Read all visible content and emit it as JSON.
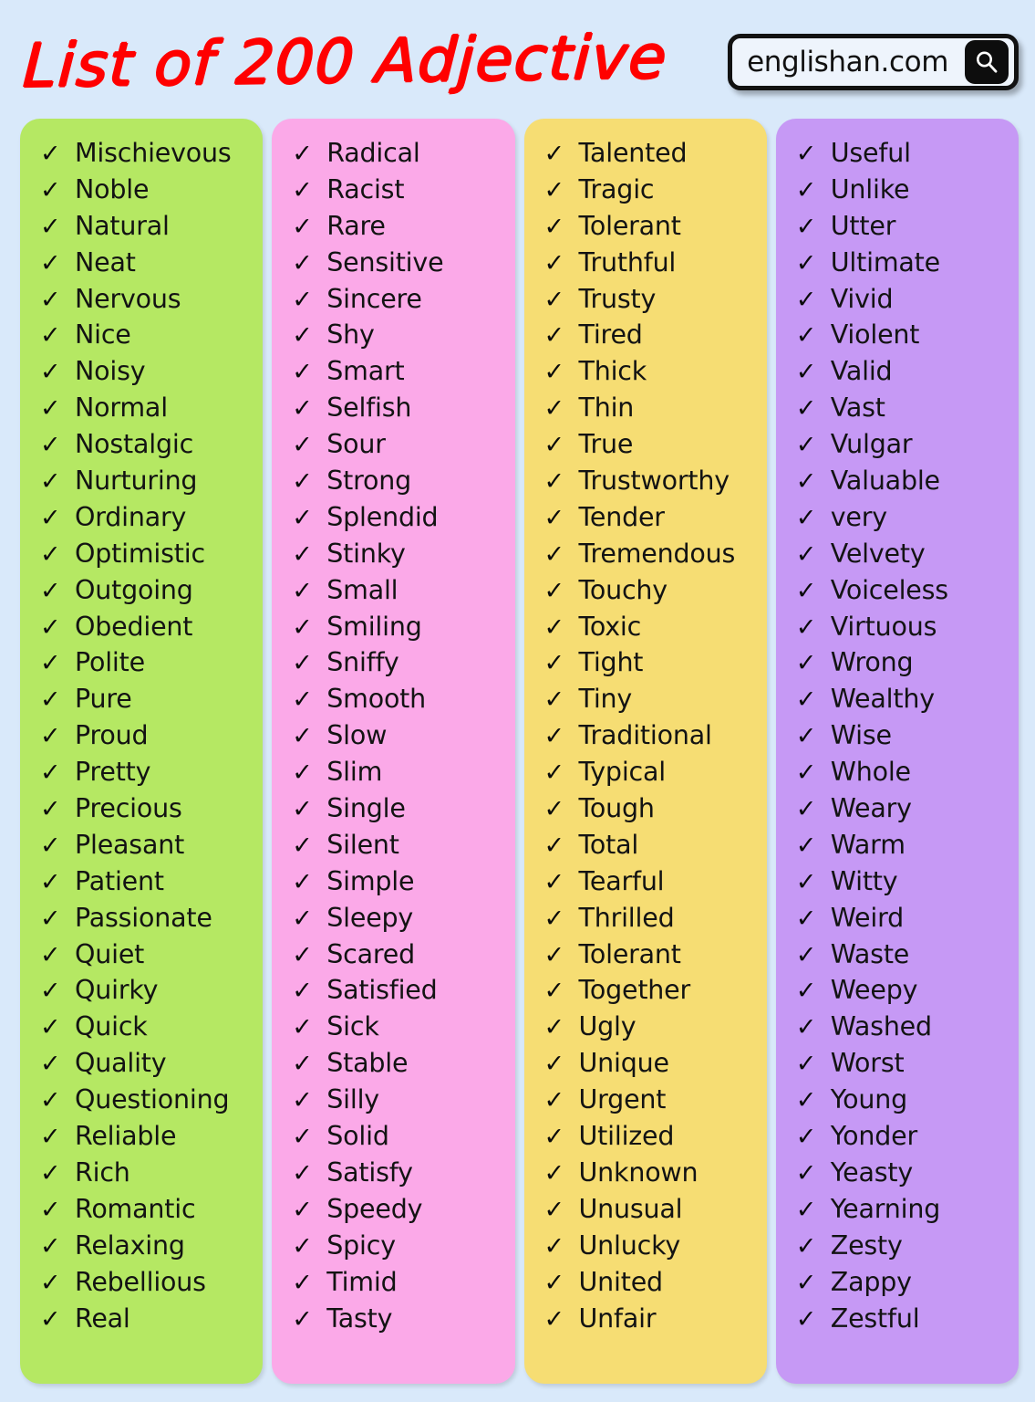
{
  "header": {
    "title": "List of 200 Adjective",
    "search": {
      "site_label": "englishan.com",
      "button_icon": "search-icon"
    }
  },
  "theme": {
    "page_background": "#d9e9fa",
    "title_color": "#ff0000",
    "column_colors": [
      "#b5e863",
      "#fba9e8",
      "#f6dd73",
      "#c699f5"
    ],
    "text_color": "#131313"
  },
  "bullet_icon": "check-icon",
  "bullet_glyph": "✓",
  "columns": [
    {
      "name": "column-green",
      "color": "#b5e863",
      "words": [
        "Mischievous",
        "Noble",
        "Natural",
        "Neat",
        "Nervous",
        "Nice",
        "Noisy",
        "Normal",
        "Nostalgic",
        "Nurturing",
        "Ordinary",
        "Optimistic",
        "Outgoing",
        "Obedient",
        "Polite",
        "Pure",
        "Proud",
        "Pretty",
        "Precious",
        "Pleasant",
        "Patient",
        "Passionate",
        "Quiet",
        "Quirky",
        "Quick",
        "Quality",
        "Questioning",
        "Reliable",
        "Rich",
        "Romantic",
        "Relaxing",
        "Rebellious",
        "Real"
      ]
    },
    {
      "name": "column-pink",
      "color": "#fba9e8",
      "words": [
        "Radical",
        "Racist",
        "Rare",
        "Sensitive",
        "Sincere",
        "Shy",
        "Smart",
        "Selfish",
        "Sour",
        "Strong",
        "Splendid",
        "Stinky",
        "Small",
        "Smiling",
        "Sniffy",
        "Smooth",
        "Slow",
        "Slim",
        "Single",
        "Silent",
        "Simple",
        "Sleepy",
        "Scared",
        "Satisfied",
        "Sick",
        "Stable",
        "Silly",
        "Solid",
        "Satisfy",
        "Speedy",
        "Spicy",
        "Timid",
        "Tasty"
      ]
    },
    {
      "name": "column-yellow",
      "color": "#f6dd73",
      "words": [
        "Talented",
        "Tragic",
        "Tolerant",
        "Truthful",
        "Trusty",
        "Tired",
        "Thick",
        "Thin",
        "True",
        "Trustworthy",
        "Tender",
        "Tremendous",
        "Touchy",
        "Toxic",
        "Tight",
        "Tiny",
        "Traditional",
        "Typical",
        "Tough",
        "Total",
        "Tearful",
        "Thrilled",
        "Tolerant",
        "Together",
        "Ugly",
        "Unique",
        "Urgent",
        "Utilized",
        "Unknown",
        "Unusual",
        "Unlucky",
        "United",
        "Unfair"
      ]
    },
    {
      "name": "column-purple",
      "color": "#c699f5",
      "words": [
        "Useful",
        "Unlike",
        "Utter",
        "Ultimate",
        "Vivid",
        "Violent",
        "Valid",
        "Vast",
        "Vulgar",
        "Valuable",
        "very",
        "Velvety",
        "Voiceless",
        "Virtuous",
        "Wrong",
        "Wealthy",
        "Wise",
        "Whole",
        "Weary",
        "Warm",
        "Witty",
        "Weird",
        "Waste",
        "Weepy",
        "Washed",
        "Worst",
        "Young",
        "Yonder",
        "Yeasty",
        "Yearning",
        "Zesty",
        "Zappy",
        "Zestful"
      ]
    }
  ]
}
